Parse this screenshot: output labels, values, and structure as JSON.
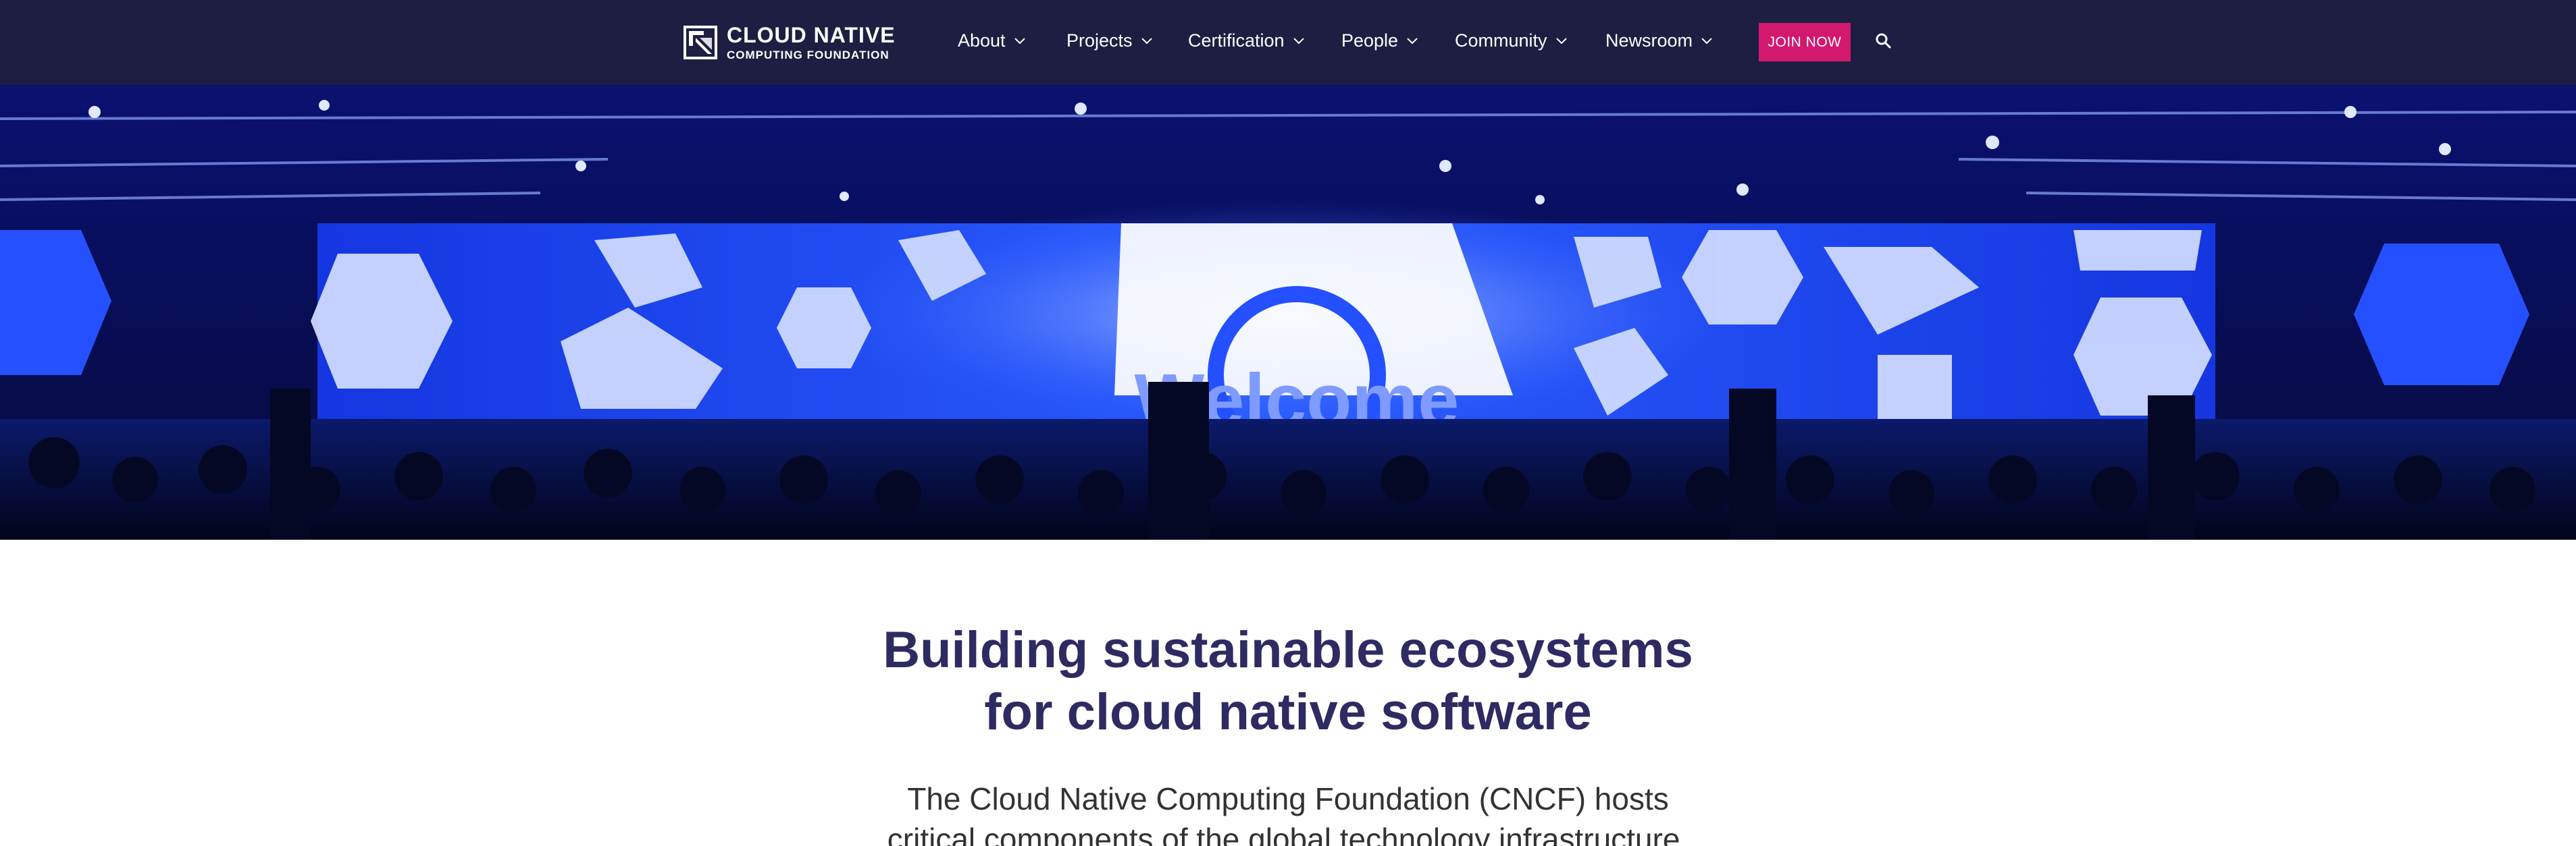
{
  "header": {
    "logo": {
      "line1": "CLOUD NATIVE",
      "line2": "COMPUTING FOUNDATION"
    },
    "nav": [
      {
        "label": "About"
      },
      {
        "label": "Projects"
      },
      {
        "label": "Certification"
      },
      {
        "label": "People"
      },
      {
        "label": "Community"
      },
      {
        "label": "Newsroom"
      }
    ],
    "join_label": "JOIN NOW",
    "search_icon": "search-icon"
  },
  "hero": {
    "screen_text": "Welcome"
  },
  "main": {
    "headline_line1": "Building sustainable ecosystems",
    "headline_line2": "for cloud native software",
    "subtext_line1": "The Cloud Native Computing Foundation (CNCF) hosts",
    "subtext_line2": "critical components of the global technology infrastructure."
  },
  "colors": {
    "header_bg": "#1d1e41",
    "accent": "#d3196e",
    "headline": "#2e2a62"
  }
}
